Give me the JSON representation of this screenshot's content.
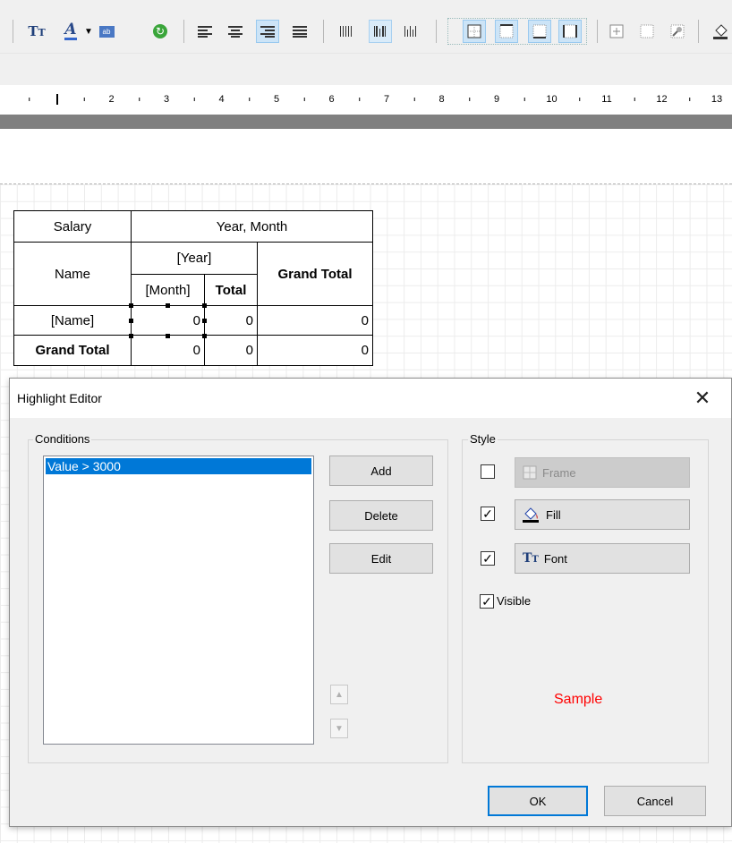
{
  "toolbar": {
    "icons": [
      "text-font-icon",
      "font-color-icon",
      "dropdown-arrow-icon",
      "text-box-icon",
      "refresh-icon",
      "align-left-icon",
      "align-center-icon",
      "align-right-icon",
      "justify-icon",
      "barcode1-icon",
      "barcode2-icon",
      "barcode3-icon",
      "frame-all-icon",
      "frame-top-icon",
      "frame-bottom-icon",
      "frame-sides-icon",
      "frame-none-icon",
      "frame-dotted-icon",
      "frame-style-icon",
      "fill-icon"
    ]
  },
  "ruler": {
    "numbers": [
      "2",
      "3",
      "4",
      "5",
      "6",
      "7",
      "8",
      "9",
      "10",
      "11",
      "12",
      "13"
    ]
  },
  "crosstab": {
    "salary": "Salary",
    "year_month": "Year, Month",
    "name": "Name",
    "year": "[Year]",
    "grand_total_header": "Grand Total",
    "month": "[Month]",
    "total": "Total",
    "name_field": "[Name]",
    "grand_total_row": "Grand Total",
    "cells": [
      "0",
      "0",
      "0",
      "0",
      "0",
      "0"
    ]
  },
  "dialog": {
    "title": "Highlight Editor",
    "close_glyph": "✕",
    "conditions_label": "Conditions",
    "conditions": [
      "Value > 3000"
    ],
    "add_label": "Add",
    "delete_label": "Delete",
    "edit_label": "Edit",
    "style_label": "Style",
    "frame_label": "Frame",
    "fill_label": "Fill",
    "font_label": "Font",
    "visible_label": "Visible",
    "frame_checked": false,
    "fill_checked": true,
    "font_checked": true,
    "visible_checked": true,
    "sample_label": "Sample",
    "sample_color": "#ff0000",
    "ok_label": "OK",
    "cancel_label": "Cancel",
    "check_glyph": "✓",
    "up_glyph": "▲",
    "down_glyph": "▼"
  },
  "colors": {
    "selection": "#0078d7",
    "accent_border": "#0078d7",
    "dialog_bg": "#f0f0f0"
  }
}
